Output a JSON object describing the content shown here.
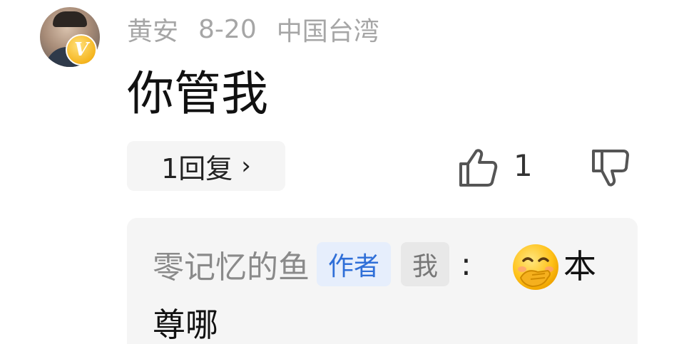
{
  "comment": {
    "username": "黄安",
    "date": "8-20",
    "location": "中国台湾",
    "badge_letter": "V",
    "text": "你管我",
    "replies_label": "1回复",
    "replies_chevron": "›",
    "like_count": "1"
  },
  "reply": {
    "author": "零记忆的鱼",
    "author_tag": "作者",
    "me_tag": "我",
    "separator": ":",
    "text_line1": "本",
    "text_line2": "尊哪",
    "emoji": "face-with-hand-over-mouth"
  },
  "colors": {
    "meta_gray": "#a6a6a6",
    "author_tag_blue": "#2f6fd8",
    "badge_gold": "#f5b51f"
  }
}
